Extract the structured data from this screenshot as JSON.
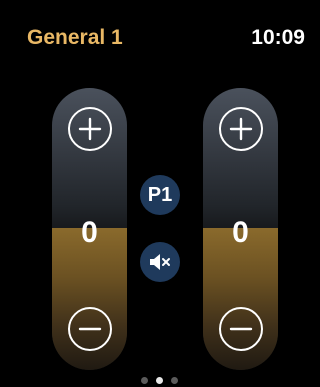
{
  "header": {
    "title": "General 1",
    "time": "10:09"
  },
  "sliders": [
    {
      "value": "0"
    },
    {
      "value": "0"
    }
  ],
  "preset_button": {
    "label": "P1"
  },
  "mute_button": {
    "icon": "speaker-muted-icon"
  },
  "pager": {
    "count": 3,
    "active_index": 1
  },
  "colors": {
    "accent": "#e9b865",
    "background": "#000000",
    "button_fill": "#1f3a5c"
  }
}
